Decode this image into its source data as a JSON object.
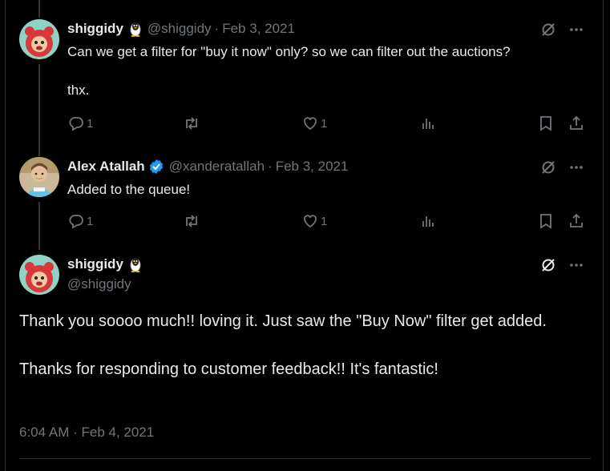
{
  "tweets": [
    {
      "name": "shiggidy",
      "handle": "@shiggidy",
      "date": "Feb 3, 2021",
      "text": "Can we get a filter for \"buy it now\" only? so we can filter out the auctions?\n\nthx.",
      "replies": "1",
      "retweets": "",
      "likes": "1"
    },
    {
      "name": "Alex Atallah",
      "handle": "@xanderatallah",
      "date": "Feb 3, 2021",
      "text": "Added to the queue!",
      "replies": "1",
      "retweets": "",
      "likes": "1"
    }
  ],
  "main_tweet": {
    "name": "shiggidy",
    "handle": "@shiggidy",
    "text": "Thank you soooo much!! loving it.  Just saw the \"Buy Now\" filter get added.\n\nThanks for responding to customer feedback!! It's fantastic!",
    "timestamp": "6:04 AM · Feb 4, 2021"
  },
  "separator": "·",
  "colors": {
    "background": "#000000",
    "text": "#e7e9ea",
    "muted": "#71767b",
    "verified": "#1d9bf0"
  }
}
